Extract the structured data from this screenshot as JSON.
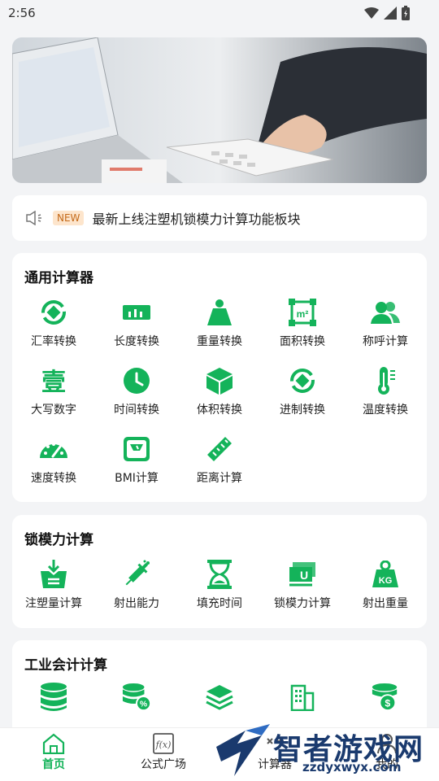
{
  "status": {
    "time": "2:56"
  },
  "notice": {
    "badge": "NEW",
    "text": "最新上线注塑机锁模力计算功能板块"
  },
  "general": {
    "title": "通用计算器",
    "items": [
      {
        "label": "汇率转换",
        "icon": "exchange-icon"
      },
      {
        "label": "长度转换",
        "icon": "ruler-icon"
      },
      {
        "label": "重量转换",
        "icon": "weight-icon"
      },
      {
        "label": "面积转换",
        "icon": "area-icon"
      },
      {
        "label": "称呼计算",
        "icon": "people-icon"
      },
      {
        "label": "大写数字",
        "icon": "capital-number-icon"
      },
      {
        "label": "时间转换",
        "icon": "clock-icon"
      },
      {
        "label": "体积转换",
        "icon": "cube-icon"
      },
      {
        "label": "进制转换",
        "icon": "base-convert-icon"
      },
      {
        "label": "温度转换",
        "icon": "thermometer-icon"
      },
      {
        "label": "速度转换",
        "icon": "speedometer-icon"
      },
      {
        "label": "BMI计算",
        "icon": "scale-icon"
      },
      {
        "label": "距离计算",
        "icon": "distance-ruler-icon"
      }
    ]
  },
  "clamp": {
    "title": "锁模力计算",
    "items": [
      {
        "label": "注塑量计算",
        "icon": "injection-volume-icon"
      },
      {
        "label": "射出能力",
        "icon": "syringe-icon"
      },
      {
        "label": "填充时间",
        "icon": "hourglass-icon"
      },
      {
        "label": "锁模力计算",
        "icon": "clamp-force-icon"
      },
      {
        "label": "射出重量",
        "icon": "kg-weight-icon"
      }
    ]
  },
  "industrial": {
    "title": "工业会计计算"
  },
  "nav": {
    "items": [
      {
        "label": "首页",
        "icon": "home-icon",
        "active": true
      },
      {
        "label": "公式广场",
        "icon": "formula-icon",
        "active": false
      },
      {
        "label": "计算器",
        "icon": "calculator-icon",
        "active": false
      },
      {
        "label": "我的",
        "icon": "user-icon",
        "active": false
      }
    ]
  },
  "watermark": {
    "title": "智者游戏网",
    "url": "zzdyxwyx.com"
  },
  "colors": {
    "accent": "#14b35a",
    "background": "#f3f4f6"
  }
}
